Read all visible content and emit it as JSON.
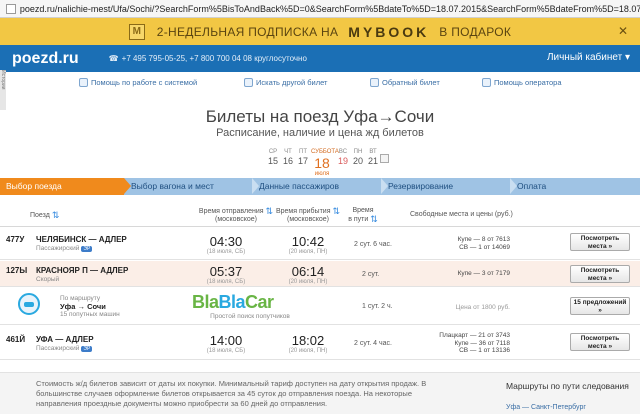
{
  "browser": {
    "url": "poezd.ru/nalichie-mest/Ufa/Sochi/?SearchForm%5BisToAndBack%5D=0&SearchForm%5BdateTo%5D=18.07.2015&SearchForm%5BdateFrom%5D=18.07.20"
  },
  "promo": {
    "icon_letter": "M",
    "text_before": "2-НЕДЕЛЬНАЯ ПОДПИСКА НА",
    "brand": "MYBOOK",
    "text_after": "В ПОДАРОК",
    "close": "✕"
  },
  "header": {
    "logo": "poezd.ru",
    "phones": "+7 495 795-05-25, +7 800 700 04 08 круглосуточно",
    "cabinet": "Личный кабинет ▾"
  },
  "side_tab": "Истории",
  "tools": [
    {
      "label": "Помощь по работе с системой"
    },
    {
      "label": "Искать другой билет"
    },
    {
      "label": "Обратный билет"
    },
    {
      "label": "Помощь оператора"
    }
  ],
  "title": "Билеты на поезд Уфа→Сочи",
  "subtitle": "Расписание, наличие и цена жд билетов",
  "dates": [
    {
      "dn": "СР",
      "dd": "15"
    },
    {
      "dn": "ЧТ",
      "dd": "16"
    },
    {
      "dn": "ПТ",
      "dd": "17"
    },
    {
      "dn": "СУББОТА",
      "dd": "18",
      "month": "июля"
    },
    {
      "dn": "ВС",
      "dd": "19"
    },
    {
      "dn": "ПН",
      "dd": "20"
    },
    {
      "dn": "ВТ",
      "dd": "21"
    }
  ],
  "steps": [
    "Выбор поезда",
    "Выбор вагона и мест",
    "Данные пассажиров",
    "Резервирование",
    "Оплата"
  ],
  "columns": {
    "train": "Поезд",
    "depart": "Время отправления",
    "depart_sub": "(московское)",
    "arrive": "Время прибытия",
    "arrive_sub": "(московское)",
    "travel": "Время",
    "travel_sub": "в пути",
    "seats": "Свободные места и цены (руб.)"
  },
  "trains": [
    {
      "num": "477У",
      "route": "ЧЕЛЯБИНСК — АДЛЕР",
      "type": "Пассажирский",
      "badge": "ЭР",
      "dep": "04:30",
      "dep_date": "(18 июля, СБ)",
      "arr": "10:42",
      "arr_date": "(20 июля, ПН)",
      "dur": "2 сут. 6 час.",
      "seats": [
        "Купе — 8  от 7613",
        "СВ — 1  от 14069"
      ],
      "button": "Посмотреть места »"
    },
    {
      "num": "127Ы",
      "route": "КРАСНОЯР П — АДЛЕР",
      "type": "Скорый",
      "badge": "",
      "dep": "05:37",
      "dep_date": "(18 июля, СБ)",
      "arr": "06:14",
      "arr_date": "(20 июля, ПН)",
      "dur": "2 сут.",
      "seats": [
        "Купе — 3  от 7179"
      ],
      "button": "Посмотреть места »"
    },
    {
      "num": "461Й",
      "route": "УФА — АДЛЕР",
      "type": "Пассажирский",
      "badge": "ЭР",
      "dep": "14:00",
      "dep_date": "(18 июля, СБ)",
      "arr": "18:02",
      "arr_date": "(20 июля, ПН)",
      "dur": "2 сут. 4 час.",
      "seats": [
        "Плацкарт — 21  от 3743",
        "Купе — 36  от 7118",
        "СВ — 1  от 13136"
      ],
      "button": "Посмотреть места »"
    }
  ],
  "blablacar": {
    "line1": "По маршруту",
    "line2": "Уфа → Сочи",
    "line3": "15 попутных машин",
    "logo_a": "Bla",
    "logo_b": "Bla",
    "logo_c": "Car",
    "tagline": "Простой поиск попутчиков",
    "dur": "1 сут. 2 ч.",
    "price": "Цена от 1800 руб.",
    "button": "15 предложений »"
  },
  "footer": {
    "text": "Стоимость ж/д билетов зависит от даты их покупки. Минимальный тариф доступен на дату открытия продаж. В большинстве случаев оформление билетов открывается за 45 суток до отправления поезда. На некоторые направления проездные документы можно приобрести за 60 дней до отправления.",
    "side_title": "Маршруты по пути следования",
    "side_link": "Уфа — Санкт-Петербург"
  }
}
